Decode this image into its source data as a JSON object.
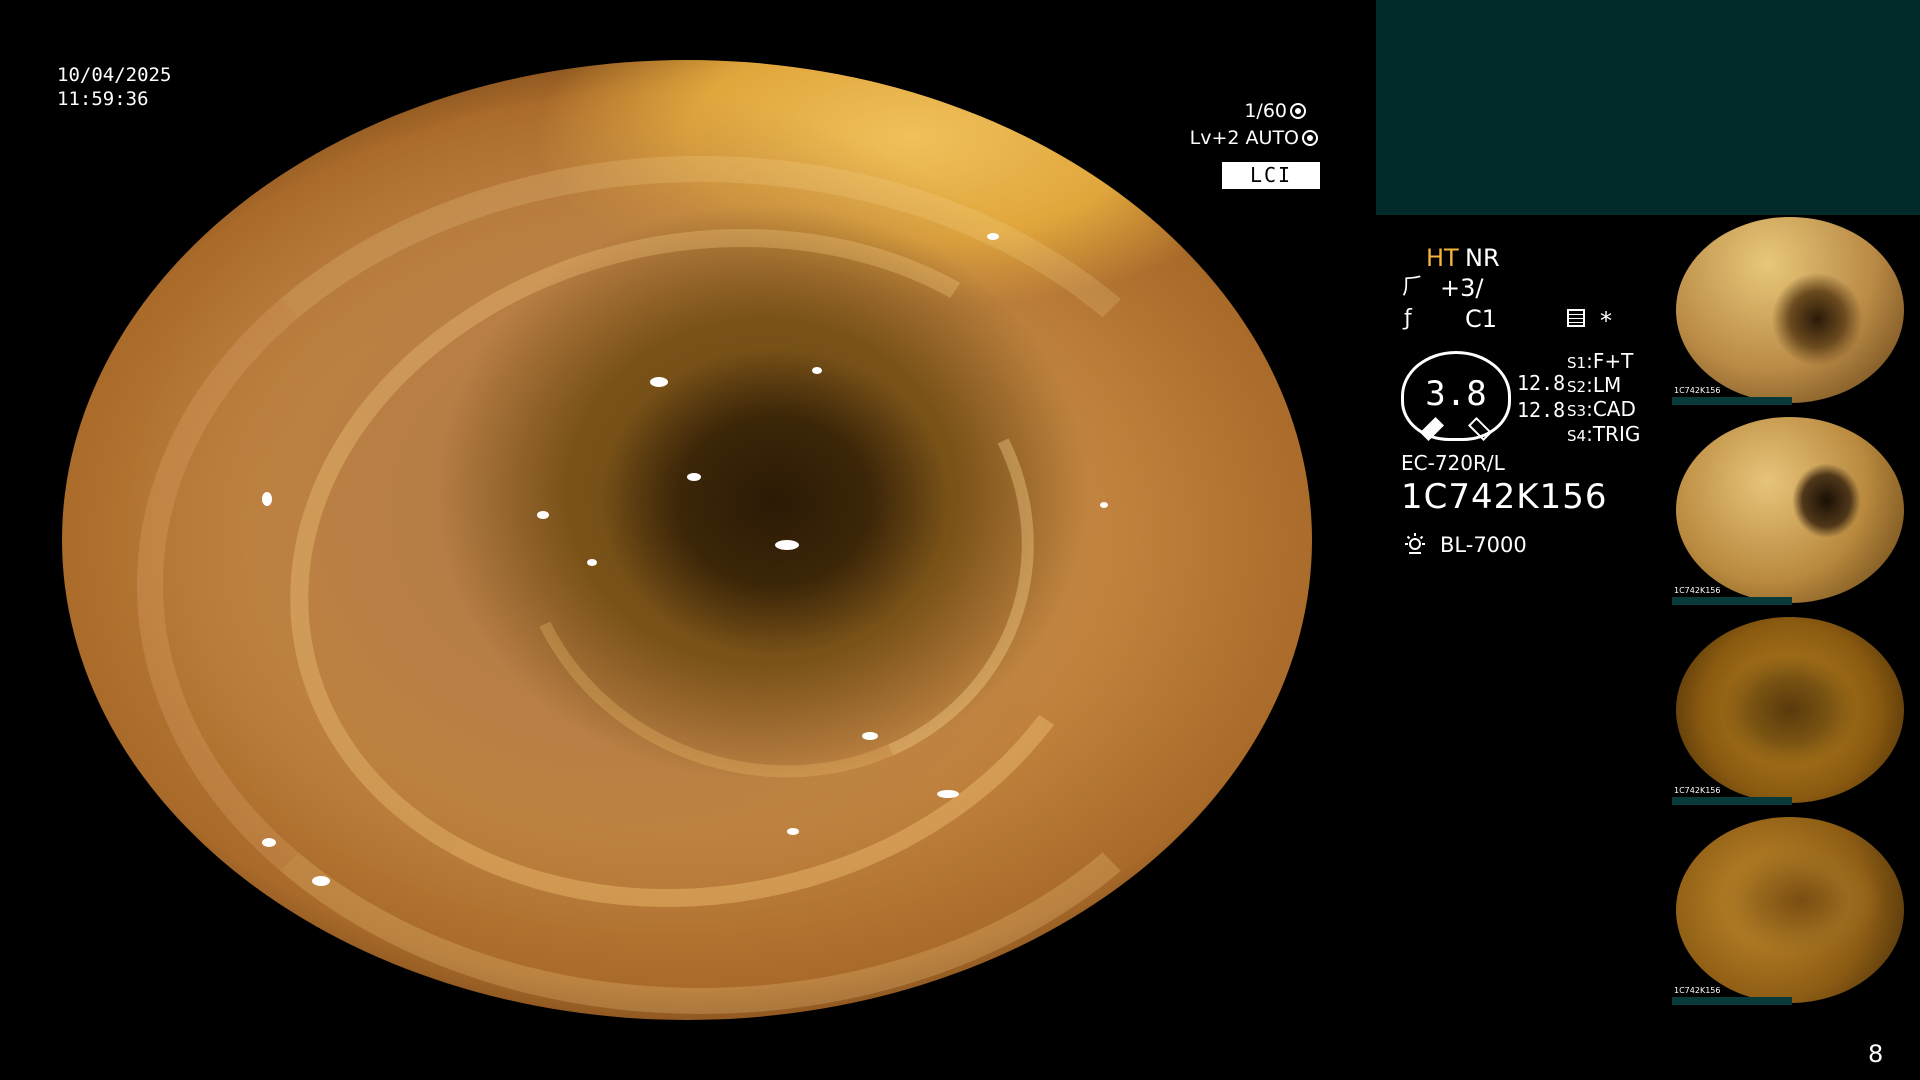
{
  "overlay": {
    "date": "10/04/2025",
    "time": "11:59:36",
    "shutter": "1/60",
    "level": "Lv+2 AUTO",
    "mode": "LCI"
  },
  "status": {
    "ht": "HT",
    "nr": "NR",
    "enhancement": "+3/",
    "color": "C1",
    "star": "*",
    "gauge_value": "3.8",
    "readout1": "12.8",
    "readout2": "12.8",
    "switches": [
      {
        "key": "S1",
        "value": "F+T"
      },
      {
        "key": "S2",
        "value": "LM"
      },
      {
        "key": "S3",
        "value": "CAD"
      },
      {
        "key": "S4",
        "value": "TRIG"
      }
    ],
    "scope_model": "EC-720R/L",
    "serial": "1C742K156",
    "light_source": "BL-7000"
  },
  "thumbnails": [
    {
      "caption": "1C742K156"
    },
    {
      "caption": "1C742K156"
    },
    {
      "caption": "1C742K156"
    },
    {
      "caption": "1C742K156"
    }
  ],
  "page_number": "8",
  "colors": {
    "background": "#000000",
    "panel": "#032a2a",
    "ht_accent": "#f5b43a",
    "badge": "#ffffff"
  },
  "icons": {
    "shutter": "aperture-icon",
    "level": "iris-icon",
    "enhancement": "structure-enhance-icon",
    "color": "color-enhance-icon",
    "memo": "memo-icon",
    "light": "light-source-icon"
  }
}
